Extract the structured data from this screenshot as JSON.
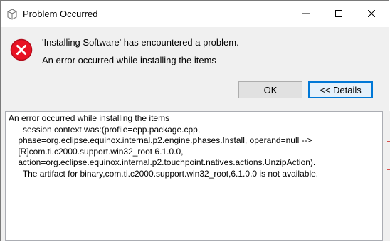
{
  "window": {
    "title": "Problem Occurred"
  },
  "dialog": {
    "message_title": "'Installing Software' has encountered a problem.",
    "message_detail": "An error occurred while installing the items"
  },
  "buttons": {
    "ok_label": "OK",
    "details_label": "<< Details"
  },
  "details": {
    "text": "An error occurred while installing the items\n      session context was:(profile=epp.package.cpp,\n    phase=org.eclipse.equinox.internal.p2.engine.phases.Install, operand=null -->\n    [R]com.ti.c2000.support.win32_root 6.1.0.0,\n    action=org.eclipse.equinox.internal.p2.touchpoint.natives.actions.UnzipAction).\n      The artifact for binary,com.ti.c2000.support.win32_root,6.1.0.0 is not available."
  },
  "icons": {
    "app": "app-icon",
    "error": "error-icon",
    "minimize": "minimize-icon",
    "maximize": "maximize-icon",
    "close": "close-icon"
  },
  "colors": {
    "error_red": "#e81123",
    "focus_blue": "#0078d7"
  }
}
